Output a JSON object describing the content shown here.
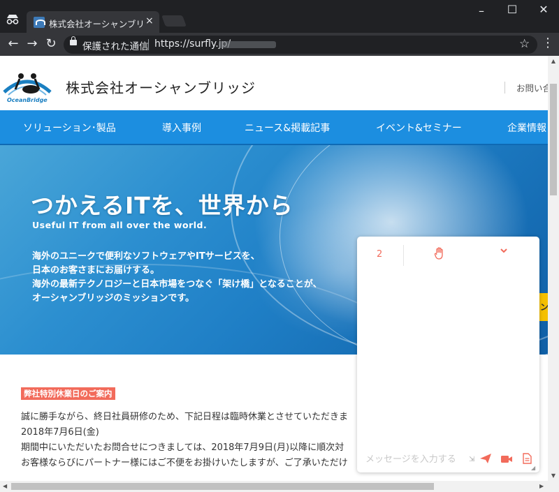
{
  "browser": {
    "tab_title": "株式会社オーシャンブリッジ",
    "tab_close": "×",
    "address_secure": "保護された通信",
    "address_url": "https://surfly.jp/"
  },
  "site": {
    "company_name": "株式会社オーシャンブリッジ",
    "logo_text": "OceanBridge",
    "header_link": "お問い合",
    "nav": [
      "ソリューション･製品",
      "導入事例",
      "ニュース&掲載記事",
      "イベント&セミナー",
      "企業情報"
    ],
    "hero": {
      "title": "つかえるITを、世界から",
      "subtitle": "Useful IT from all over the world.",
      "lines": [
        "海外のユニークで便利なソフトウェアやITサービスを、",
        "日本のお客さまにお届けする。",
        "海外の最新テクノロジーと日本市場をつなぐ「架け橋」となることが、",
        "オーシャンブリッジのミッションです。"
      ],
      "yellow_tab_text": "ン"
    },
    "notice": {
      "badge": "弊社特別休業日のご案内",
      "lines": [
        "誠に勝手ながら、終日社員研修のため、下記日程は臨時休業とさせていただきま",
        "2018年7月6日(金)",
        "期間中にいただいたお問合せにつきましては、2018年7月9日(月)以降に順次対",
        "お客様ならびにパートナー様にはご不便をお掛けいたしますが、ご了承いただけ"
      ]
    }
  },
  "chat": {
    "participants_count": "2",
    "message_placeholder": "メッセージを入力する"
  },
  "icons": {
    "hand": "hand-icon",
    "chevron": "chevron-down-icon",
    "send": "send-icon",
    "video": "video-icon",
    "document": "document-icon"
  },
  "colors": {
    "nav_blue": "#1c8ee0",
    "accent_red": "#f26b5b",
    "chrome_dark": "#202124"
  }
}
